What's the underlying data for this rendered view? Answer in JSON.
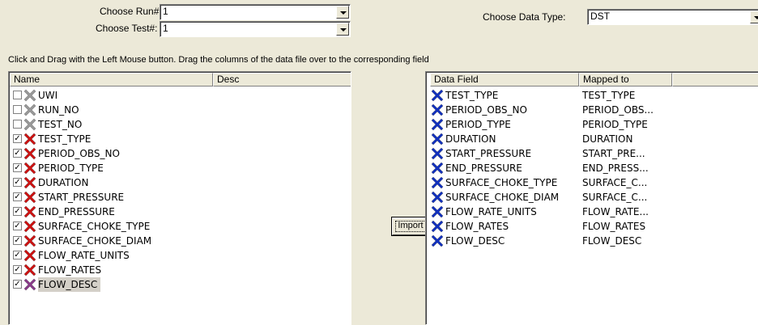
{
  "run": {
    "label": "Choose Run#:",
    "value": "1"
  },
  "test": {
    "label": "Choose Test#:",
    "value": "1"
  },
  "data_type": {
    "label": "Choose Data Type:",
    "value": "DST"
  },
  "instructions": "Click and Drag with the Left Mouse button. Drag the columns of the data file over to the corresponding field",
  "left_list": {
    "headers": [
      "Name",
      "Desc"
    ],
    "items": [
      {
        "name": "UWI",
        "checked": false,
        "icon": "grey-x-icon"
      },
      {
        "name": "RUN_NO",
        "checked": false,
        "icon": "grey-x-icon"
      },
      {
        "name": "TEST_NO",
        "checked": false,
        "icon": "grey-x-icon"
      },
      {
        "name": "TEST_TYPE",
        "checked": true,
        "icon": "red-x-icon"
      },
      {
        "name": "PERIOD_OBS_NO",
        "checked": true,
        "icon": "red-x-icon"
      },
      {
        "name": "PERIOD_TYPE",
        "checked": true,
        "icon": "red-x-icon"
      },
      {
        "name": "DURATION",
        "checked": true,
        "icon": "red-x-icon"
      },
      {
        "name": "START_PRESSURE",
        "checked": true,
        "icon": "red-x-icon"
      },
      {
        "name": "END_PRESSURE",
        "checked": true,
        "icon": "red-x-icon"
      },
      {
        "name": "SURFACE_CHOKE_TYPE",
        "checked": true,
        "icon": "red-x-icon"
      },
      {
        "name": "SURFACE_CHOKE_DIAM",
        "checked": true,
        "icon": "red-x-icon"
      },
      {
        "name": "FLOW_RATE_UNITS",
        "checked": true,
        "icon": "red-x-icon"
      },
      {
        "name": "FLOW_RATES",
        "checked": true,
        "icon": "red-x-icon"
      },
      {
        "name": "FLOW_DESC",
        "checked": true,
        "icon": "purple-x-icon",
        "selected": true
      }
    ]
  },
  "import_button": "Import",
  "right_list": {
    "headers": [
      "Data Field",
      "Mapped to"
    ],
    "items": [
      {
        "field": "TEST_TYPE",
        "mapped": "TEST_TYPE"
      },
      {
        "field": "PERIOD_OBS_NO",
        "mapped": "PERIOD_OBS..."
      },
      {
        "field": "PERIOD_TYPE",
        "mapped": "PERIOD_TYPE"
      },
      {
        "field": "DURATION",
        "mapped": "DURATION"
      },
      {
        "field": "START_PRESSURE",
        "mapped": "START_PRE..."
      },
      {
        "field": "END_PRESSURE",
        "mapped": "END_PRESS..."
      },
      {
        "field": "SURFACE_CHOKE_TYPE",
        "mapped": "SURFACE_C..."
      },
      {
        "field": "SURFACE_CHOKE_DIAM",
        "mapped": "SURFACE_C..."
      },
      {
        "field": "FLOW_RATE_UNITS",
        "mapped": "FLOW_RATE..."
      },
      {
        "field": "FLOW_RATES",
        "mapped": "FLOW_RATES"
      },
      {
        "field": "FLOW_DESC",
        "mapped": "FLOW_DESC"
      }
    ]
  },
  "colors": {
    "grey_icon": "#9a9a9a",
    "red_icon": "#d01010",
    "purple_icon": "#8a3a8a",
    "blue_icon": "#1030c0"
  }
}
